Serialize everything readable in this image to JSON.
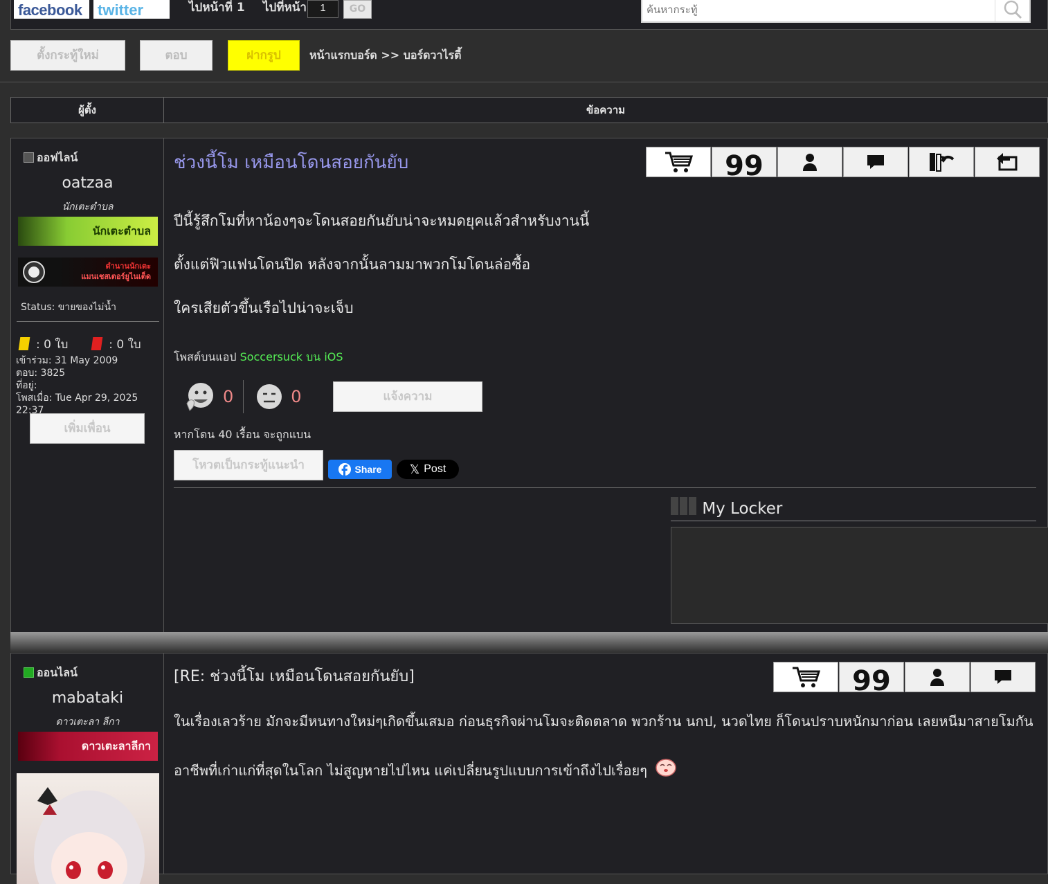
{
  "topbar": {
    "facebook": "facebook",
    "twitter": "twitter",
    "goto_page_1": "ไปหน้าที่ 1",
    "goto_page": "ไปที่หน้า",
    "page_value": "1",
    "go_label": "GO",
    "search_placeholder": "ค้นหากระทู้"
  },
  "actions": {
    "new_topic": "ตั้งกระทู้ใหม่",
    "reply": "ตอบ",
    "upload": "ฝากรูป",
    "breadcrumb": "หน้าแรกบอร์ด >> บอร์ดวาไรตี้"
  },
  "header": {
    "author": "ผู้ตั้ง",
    "message": "ข้อความ"
  },
  "post1": {
    "status": "ออฟไลน์",
    "username": "oatzaa",
    "rank": "นักเตะตำบล",
    "badge1": "นักเตะตำบล",
    "badge2_line1": "ตำนานนักเตะ",
    "badge2_line2": "แมนเชสเตอร์ยูไนเต็ด",
    "user_status": "Status: ขายของไม่น้ำ",
    "yellow_cards": ": 0 ใบ",
    "red_cards": ": 0 ใบ",
    "joined": "เข้าร่วม: 31 May 2009",
    "replies": "ตอบ: 3825",
    "location": "ที่อยู่:",
    "posted": "โพสเมื่อ: Tue Apr 29, 2025 22:37",
    "add_friend": "เพิ่มเพื่อน",
    "title": "ช่วงนี้โม เหมือนโดนสอยกันยับ",
    "body": [
      "ปีนี้รู้สึกโมที่หาน้องๆจะโดนสอยกันยับน่าจะหมดยุคแล้วสำหรับงานนี้",
      "ตั้งแต่ฟิวแฟนโดนปิด หลังจากนั้นลามมาพวกโมโดนล่อซื้อ",
      "ใครเสียตัวขึ้นเรือไปน่าจะเจ็บ"
    ],
    "via_prefix": "โพสต์บนแอป ",
    "via_app": "Soccersuck บน iOS",
    "like_count": "0",
    "dislike_count": "0",
    "report": "แจ้งความ",
    "ban_note": "หากโดน 40 เรื้อน จะถูกแบน",
    "recommend": "โหวตเป็นกระทู้แนะนำ",
    "share": "Share",
    "post": "Post",
    "locker": "My Locker"
  },
  "post2": {
    "status": "ออนไลน์",
    "username": "mabataki",
    "rank": "ดาวเตะลา ลีกา",
    "badge1": "ดาวเตะลาลีกา",
    "title": "[RE: ช่วงนี้โม เหมือนโดนสอยกันยับ]",
    "body1": "ในเรื่องเลวร้าย มักจะมีหนทางใหม่ๆเกิดขึ้นเสมอ ก่อนธุรกิจผ่านโมจะติดตลาด พวกร้าน นกป, นวดไทย ก็โดนปราบหนักมาก่อน เลยหนีมาสายโมกัน",
    "body2": "อาชีพที่เก่าแก่ที่สุดในโลก ไม่สูญหายไปไหน แค่เปลี่ยนรูปแบบการเข้าถึงไปเรื่อยๆ"
  },
  "colors": {
    "title_link": "#9999ee",
    "app_link": "#55ee55",
    "upload_bg": "#ffff00",
    "offline": "#555555",
    "online": "#22aa22"
  }
}
